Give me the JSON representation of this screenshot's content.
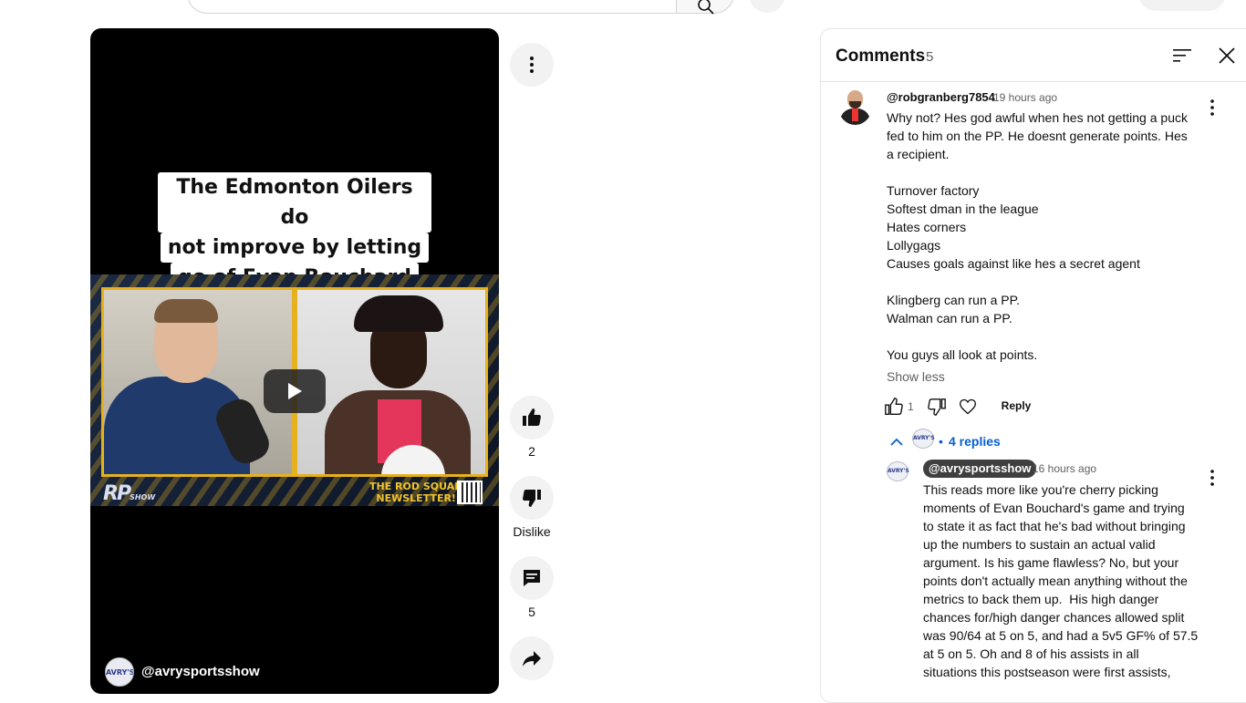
{
  "top": {
    "search_placeholder": ""
  },
  "video": {
    "title_lines": [
      "The Edmonton Oilers do",
      "not improve by letting",
      "go of Evan Bouchard"
    ],
    "overlay_logo": "RP",
    "overlay_logo_sub": "SHOW",
    "overlay_banner_line1": "THE ROD SQUAD",
    "overlay_banner_line2": "NEWSLETTER!",
    "channel_avatar_text": "AVRY'S",
    "channel_name": "@avrysportsshow"
  },
  "actions": {
    "like_count": "2",
    "dislike_label": "Dislike",
    "comment_count": "5",
    "icons": [
      "more-vert-icon",
      "thumb-up-icon",
      "thumb-down-icon",
      "comment-icon",
      "share-icon"
    ]
  },
  "comments": {
    "title": "Comments",
    "count": "5",
    "items": [
      {
        "author": "@robgranberg7854",
        "time": "19 hours ago",
        "text": "Why not? Hes god awful when hes not getting a puck\nfed to him on the PP. He doesnt generate points. Hes\na recipient.\n\nTurnover factory\nSoftest dman in the league\nHates corners\nLollygags\nCauses goals against like hes a secret agent\n\nKlingberg can run a PP.\nWalman can run a PP.\n\nYou guys all look at points.",
        "show_less": "Show less",
        "likes": "1",
        "reply_label": "Reply",
        "replies_label": "4 replies",
        "replies_separator": "•"
      },
      {
        "author": "@avrysportsshow",
        "time": "16 hours ago",
        "avatar_text": "AVRY'S",
        "text": "This reads more like you're cherry picking\nmoments of Evan Bouchard's game and trying\nto state it as fact that he's bad without bringing\nup the numbers to sustain an actual valid\nargument. Is his game flawless? No, but your\npoints don't actually mean anything without the\nmetrics to back them up.  His high danger\nchances for/high danger chances allowed split\nwas 90/64 at 5 on 5, and had a 5v5 GF% of 57.5\nat 5 on 5. Oh and 8 of his assists in all\nsituations this postseason were first assists,"
      }
    ]
  }
}
